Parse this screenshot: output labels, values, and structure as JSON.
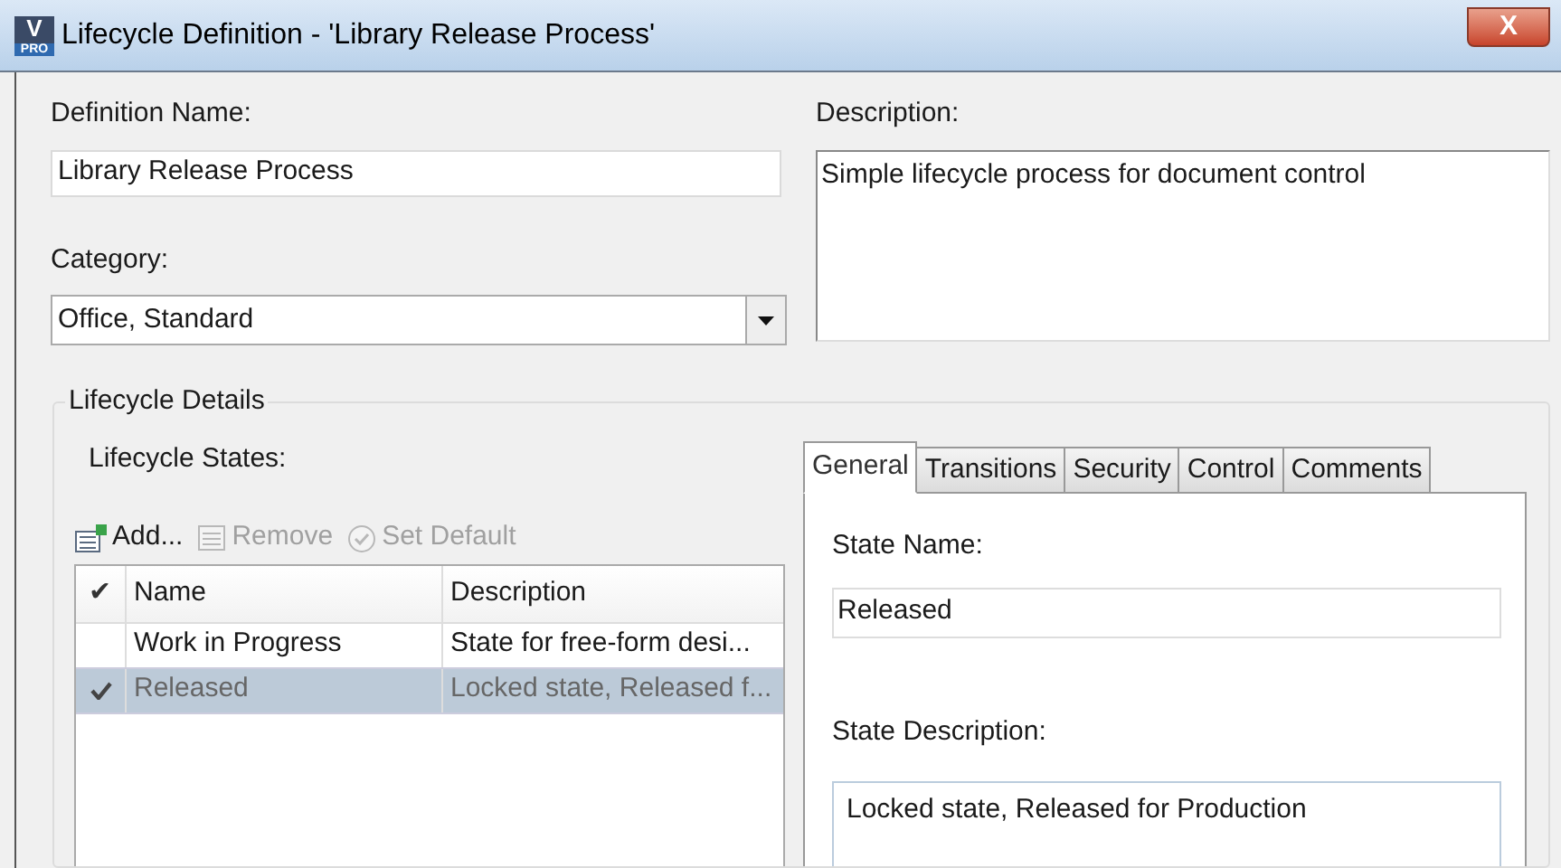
{
  "window": {
    "title": "Lifecycle Definition - 'Library Release Process'",
    "logo": {
      "letter": "V",
      "badge": "PRO"
    },
    "close": "X"
  },
  "definition_name": {
    "label": "Definition Name:",
    "value": "Library Release Process"
  },
  "category": {
    "label": "Category:",
    "value": "Office, Standard"
  },
  "description": {
    "label": "Description:",
    "value": "Simple lifecycle process for document control"
  },
  "lifecycle_details": {
    "title": "Lifecycle Details",
    "states_label": "Lifecycle States:",
    "toolbar": [
      {
        "kind": "add",
        "label": "Add...",
        "disabled": false
      },
      {
        "kind": "remove",
        "label": "Remove",
        "disabled": true
      },
      {
        "kind": "default",
        "label": "Set Default",
        "disabled": true
      }
    ],
    "table": {
      "columns": [
        "✔",
        "Name",
        "Description"
      ],
      "rows": [
        {
          "checked": false,
          "selected": false,
          "name": "Work in Progress",
          "description": "State for free-form desi..."
        },
        {
          "checked": true,
          "selected": true,
          "name": "Released",
          "description": "Locked state, Released f..."
        }
      ]
    }
  },
  "tabs": [
    {
      "label": "General",
      "selected": true
    },
    {
      "label": "Transitions",
      "selected": false
    },
    {
      "label": "Security",
      "selected": false
    },
    {
      "label": "Control",
      "selected": false
    },
    {
      "label": "Comments",
      "selected": false
    }
  ],
  "state_name": {
    "label": "State Name:",
    "value": "Released"
  },
  "state_description": {
    "label": "State Description:",
    "value": "Locked state, Released for Production"
  }
}
